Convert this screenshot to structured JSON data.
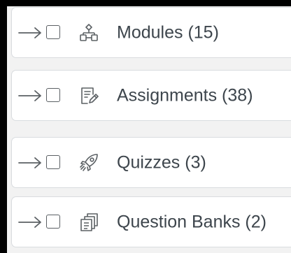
{
  "items": [
    {
      "label": "Modules (15)",
      "icon": "modules-icon"
    },
    {
      "label": "Assignments (38)",
      "icon": "assignments-icon"
    },
    {
      "label": "Quizzes (3)",
      "icon": "quizzes-rocket-icon"
    },
    {
      "label": "Question Banks (2)",
      "icon": "question-banks-icon"
    }
  ],
  "colors": {
    "text": "#3d454c",
    "border": "#d9dcdf",
    "icon": "#5b6064",
    "background": "#f2f2f2"
  }
}
